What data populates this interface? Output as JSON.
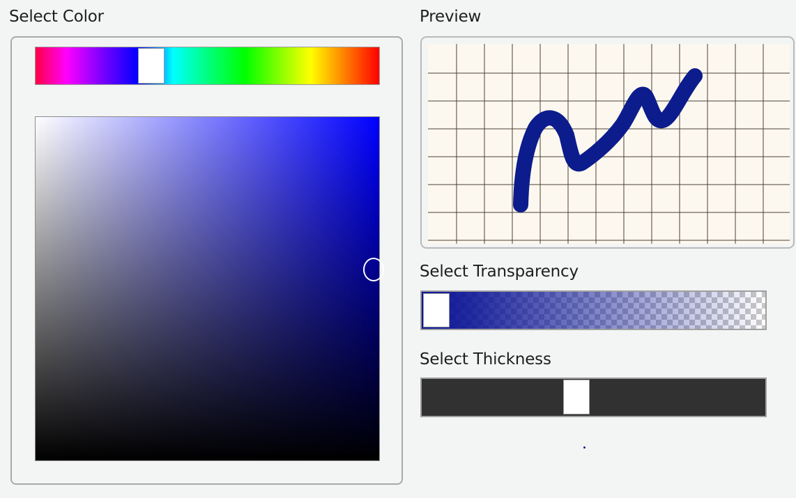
{
  "labels": {
    "select_color": "Select Color",
    "preview": "Preview",
    "select_transparency": "Select Transparency",
    "select_thickness": "Select Thickness"
  },
  "color": {
    "selected_hue": "blue",
    "stroke_color": "#0c1c8c",
    "preview_background": "#fdf8ef",
    "preview_grid_color": "#4a3f35"
  },
  "sliders": {
    "transparency_value_fraction": 0.0,
    "thickness_value_fraction": 0.45
  }
}
